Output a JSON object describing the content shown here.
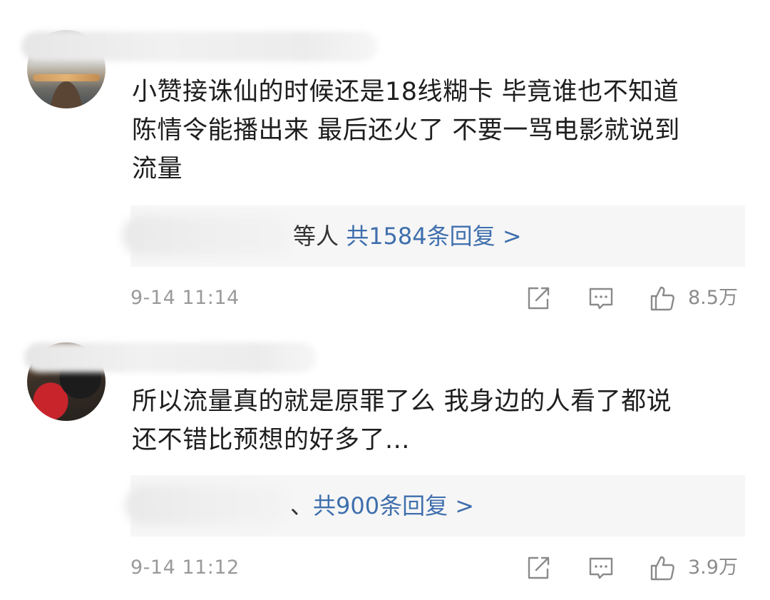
{
  "comments": [
    {
      "text_lines": [
        "小赞接诛仙的时候还是18线糊卡 毕竟谁也不知道",
        "陈情令能播出来 最后还火了 不要一骂电影就说到",
        "流量"
      ],
      "reply_suffix": "等人",
      "reply_count": "共1584条回复 >",
      "time": "9-14 11:14",
      "likes": "8.5万"
    },
    {
      "text_lines": [
        "所以流量真的就是原罪了么 我身边的人看了都说",
        "还不错比预想的好多了..."
      ],
      "reply_suffix": "、",
      "reply_count": "共900条回复 >",
      "time": "9-14 11:12",
      "likes": "3.9万"
    }
  ],
  "icons": {
    "share": "share-icon",
    "comment": "comment-icon",
    "like": "thumbs-up-icon"
  },
  "colors": {
    "reply_link": "#3f6fad",
    "meta_gray": "#9a9a9a",
    "reply_bg": "#f6f6f6"
  }
}
